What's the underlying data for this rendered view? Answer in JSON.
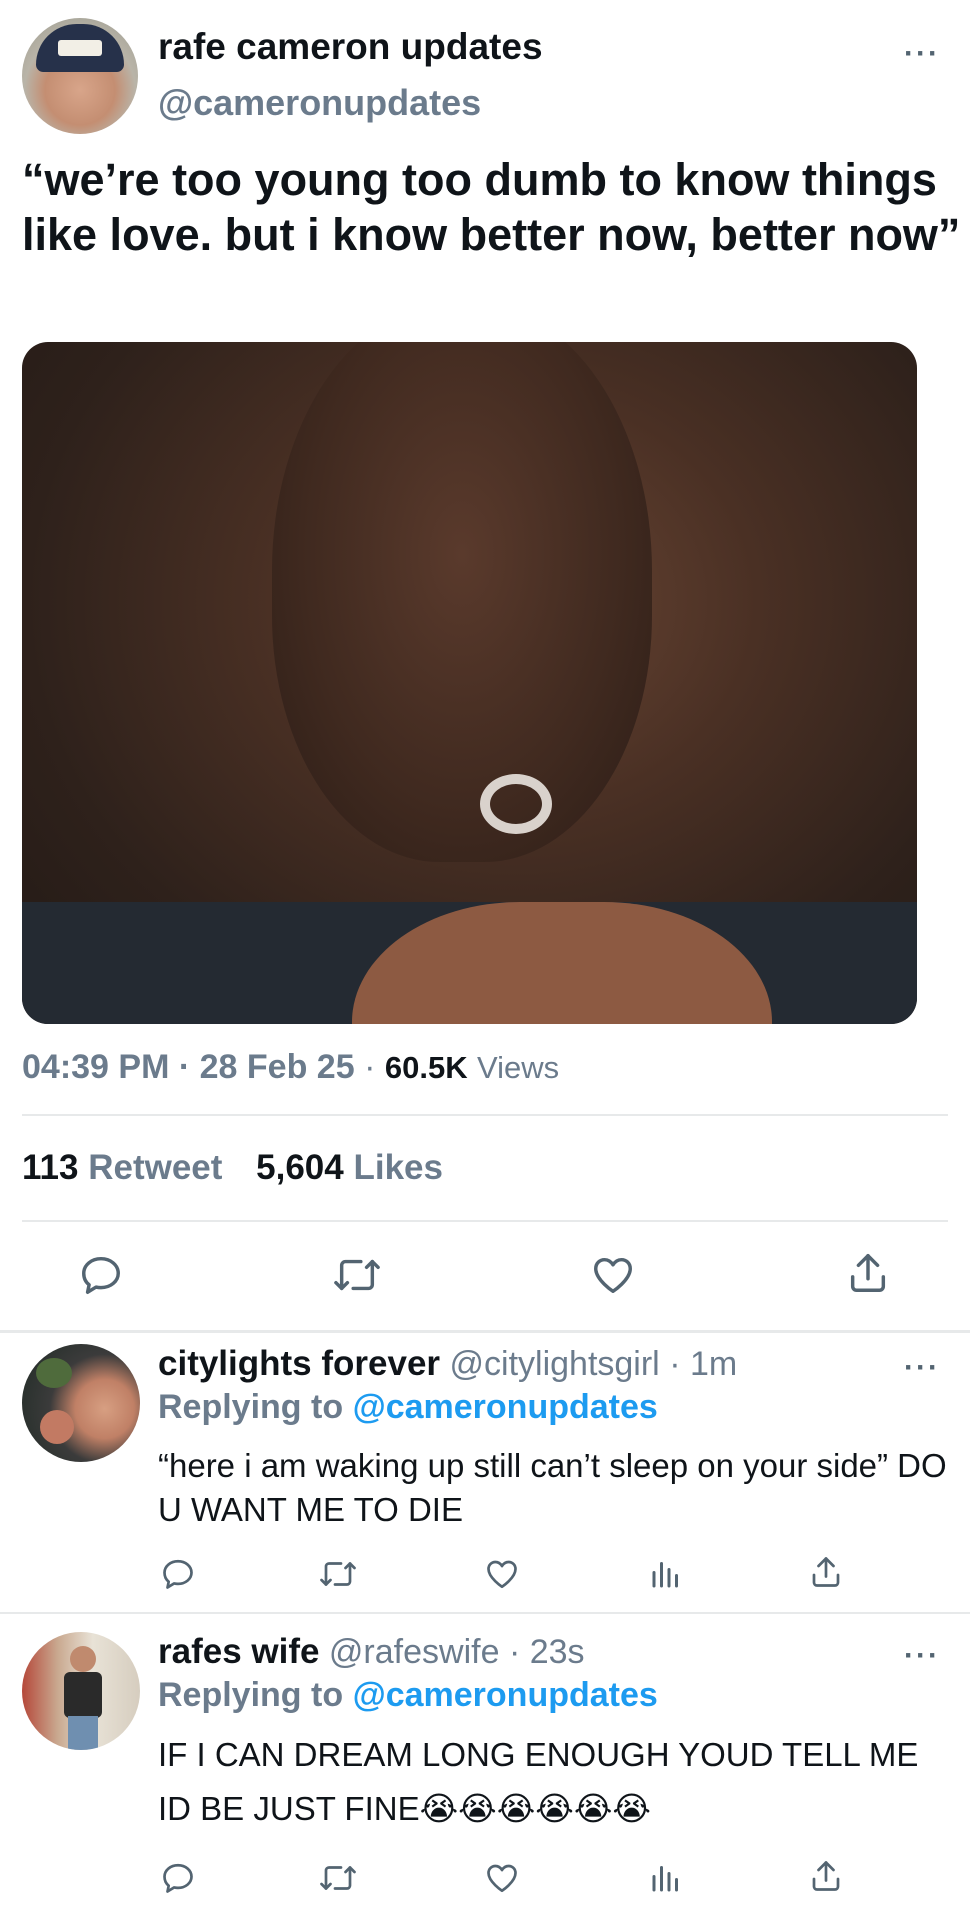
{
  "main_tweet": {
    "display_name": "rafe cameron updates",
    "handle": "@cameronupdates",
    "more": "···",
    "text": "“we’re too young too dumb to know things like love. but i know better now, better now”",
    "time": "04:39 PM",
    "sep1": "·",
    "date": "28 Feb 25",
    "sep2": "·",
    "views_count": "60.5K",
    "views_label": "Views",
    "retweets_count": "113",
    "retweets_label": "Retweet",
    "likes_count": "5,604",
    "likes_label": "Likes"
  },
  "replies": [
    {
      "display_name": "citylights forever",
      "handle": "@citylightsgirl",
      "sep": "·",
      "time": "1m",
      "replying_prefix": "Replying to",
      "replying_to": "@cameronupdates",
      "text": "“here i am waking up still can’t sleep on your side” DO U WANT ME TO DIE",
      "more": "···"
    },
    {
      "display_name": "rafes wife",
      "handle": "@rafeswife",
      "sep": "·",
      "time": "23s",
      "replying_prefix": "Replying to",
      "replying_to": "@cameronupdates",
      "text": "IF I CAN DREAM LONG ENOUGH YOUD TELL ME ID BE JUST FINE😭😭😭😭😭😭",
      "more": "···"
    }
  ],
  "icons": [
    "reply-icon",
    "retweet-icon",
    "like-icon",
    "views-icon",
    "share-icon",
    "more-icon"
  ],
  "colors": {
    "accent_blue": "#1d9bf0",
    "muted_gray": "#6b7b8c",
    "text": "#0f1419",
    "divider": "#e7e9ea"
  }
}
